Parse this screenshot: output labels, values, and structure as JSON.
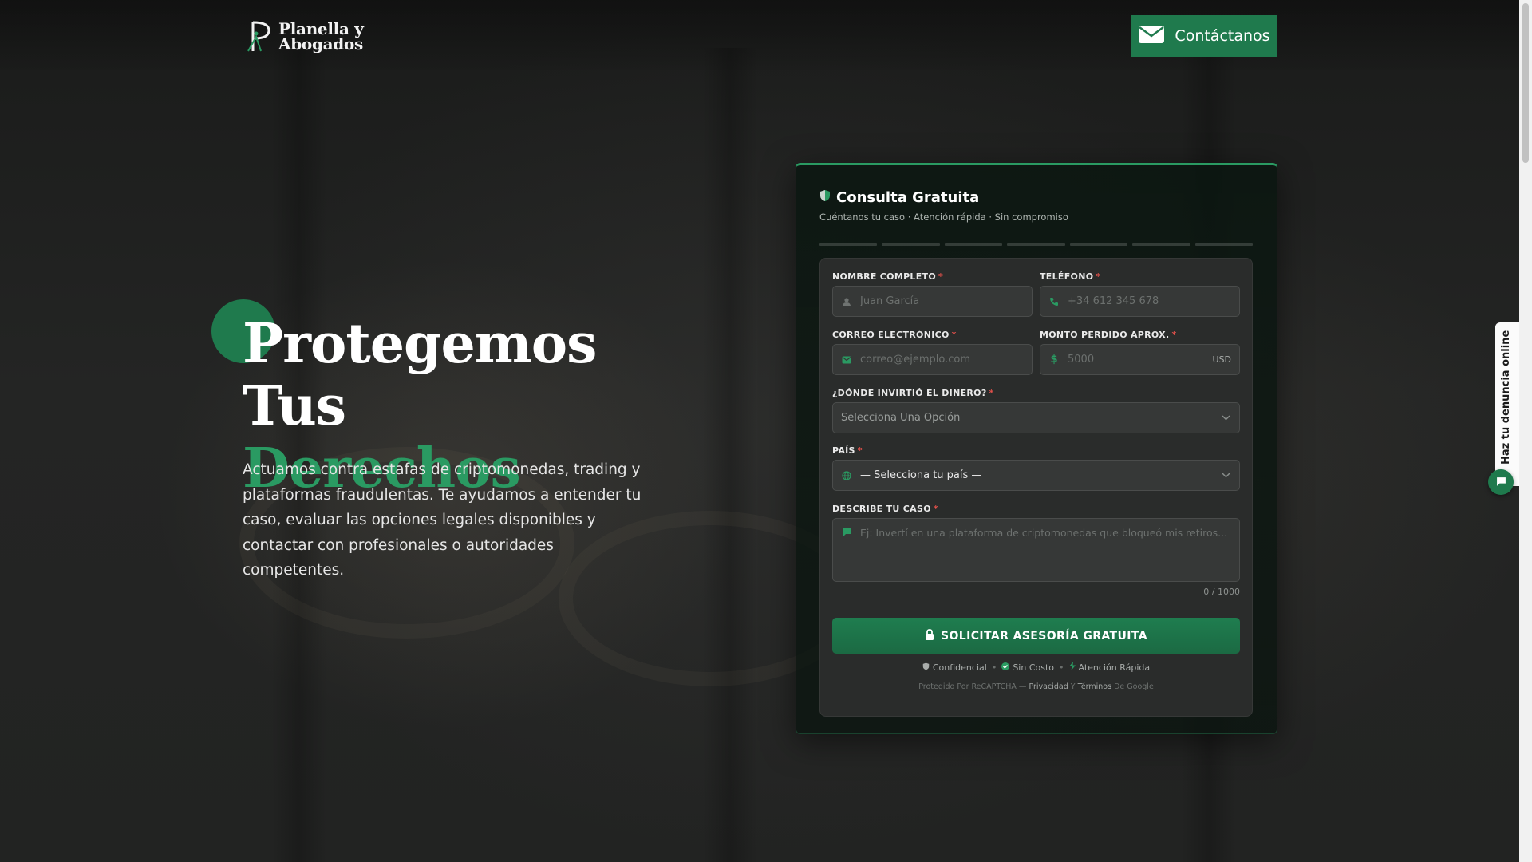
{
  "header": {
    "logo_line1": "Planella y",
    "logo_line2": "Abogados",
    "contact_label": "Contáctanos"
  },
  "hero": {
    "title_line1": "Protegemos Tus",
    "title_line2": "Derechos",
    "description": "Actuamos contra estafas de criptomonedas, trading y plataformas fraudulentas. Te ayudamos a entender tu caso, evaluar las opciones legales disponibles y contactar con profesionales o autoridades competentes."
  },
  "form": {
    "title": "Consulta Gratuita",
    "subtitle": "Cuéntanos tu caso · Atención rápida · Sin compromiso",
    "fields": {
      "name": {
        "label": "NOMBRE COMPLETO",
        "required": "*",
        "placeholder": "Juan García"
      },
      "phone": {
        "label": "TELÉFONO",
        "required": "*",
        "placeholder": "+34 612 345 678"
      },
      "email": {
        "label": "CORREO ELECTRÓNICO",
        "required": "*",
        "placeholder": "correo@ejemplo.com"
      },
      "amount": {
        "label": "MONTO PERDIDO APROX.",
        "required": "*",
        "placeholder": "5000",
        "suffix": "USD"
      },
      "where": {
        "label": "¿DÓNDE INVIRTIÓ EL DINERO?",
        "required": "*",
        "value": "Selecciona Una Opción"
      },
      "country": {
        "label": "PAÍS",
        "required": "*",
        "value": "— Selecciona tu país —"
      },
      "description": {
        "label": "DESCRIBE TU CASO",
        "required": "*",
        "placeholder": "Ej: Invertí en una plataforma de criptomonedas que bloqueó mis retiros..."
      }
    },
    "counter": "0 / 1000",
    "submit_label": "SOLICITAR ASESORÍA GRATUITA",
    "badges": [
      "Confidencial",
      "Sin Costo",
      "Atención Rápida"
    ],
    "badge_sep": "•",
    "captcha": {
      "prefix": "Protegido Por ReCAPTCHA —",
      "privacy": "Privacidad",
      "and": "Y",
      "terms": "Términos",
      "suffix": "De Google"
    }
  },
  "side_tab": {
    "label": "Haz tu denuncia online"
  },
  "colors": {
    "accent": "#1f7a4d",
    "accent_text": "#2a9a62",
    "required": "#e0504a"
  },
  "icons": [
    "envelope-icon",
    "shield-icon",
    "user-icon",
    "phone-icon",
    "mail-icon",
    "dollar-icon",
    "chevron-down-icon",
    "globe-icon",
    "comment-icon",
    "lock-icon",
    "check-circle-icon",
    "bolt-icon",
    "chat-icon"
  ]
}
